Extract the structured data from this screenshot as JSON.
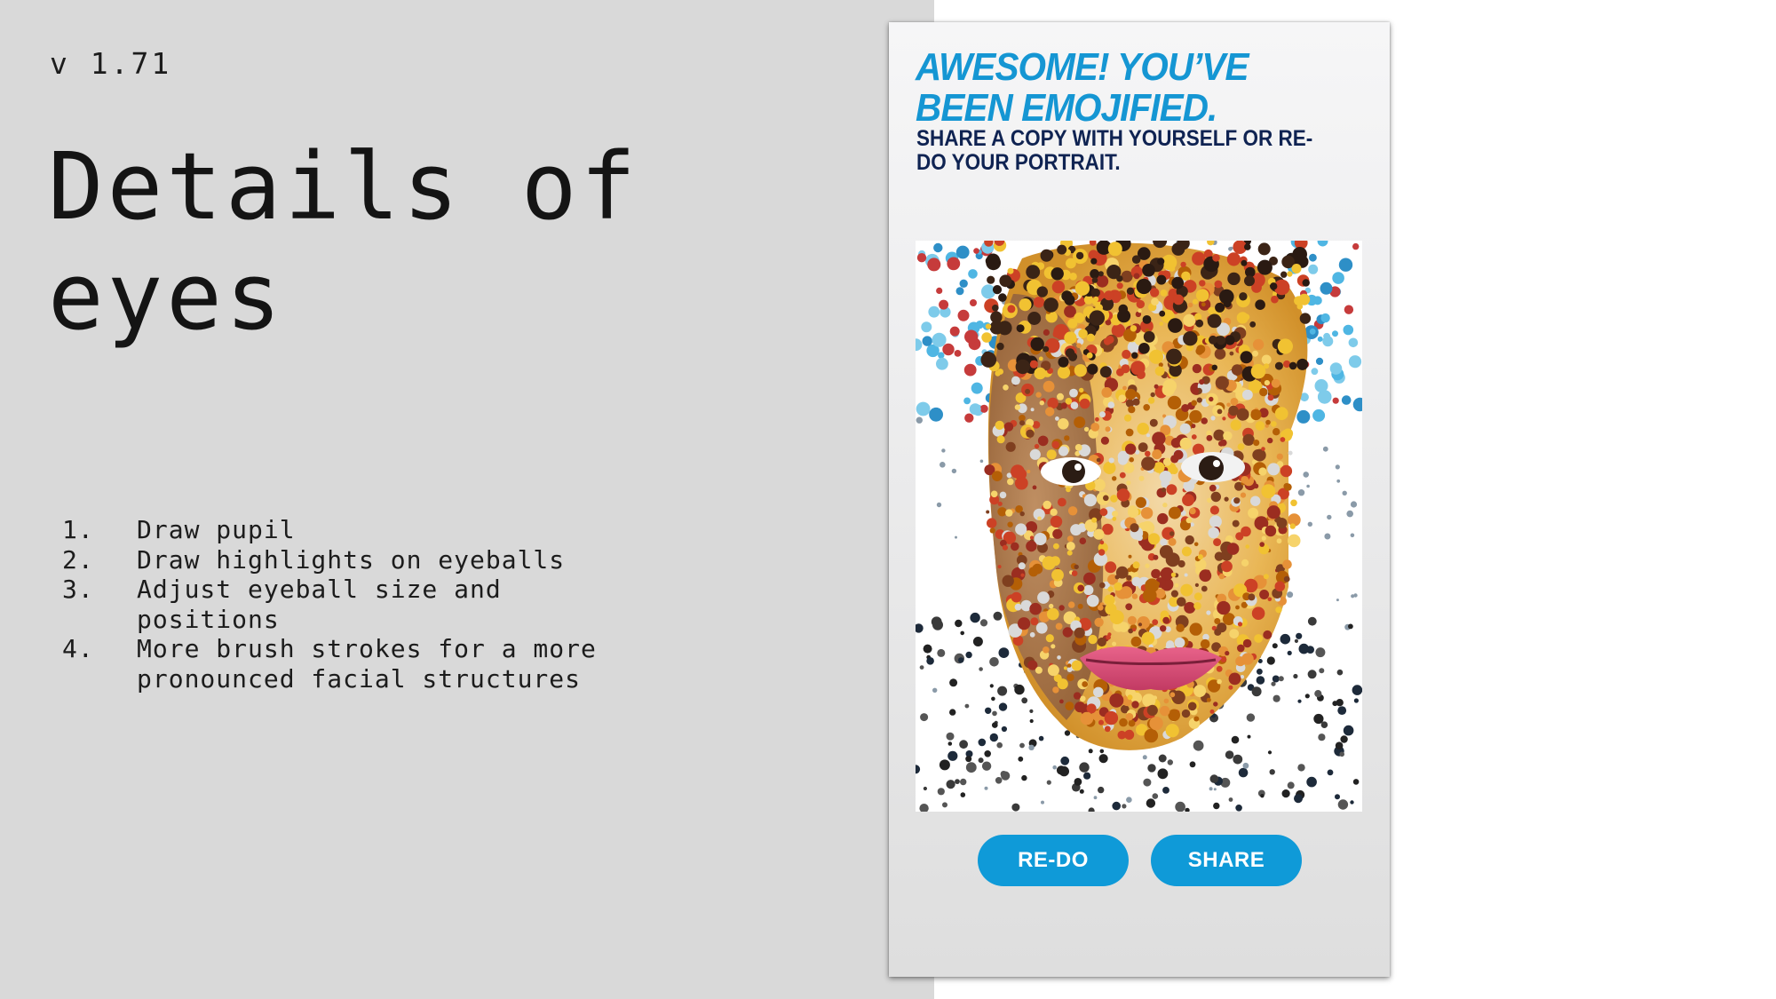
{
  "slide": {
    "version": "v 1.71",
    "title": "Details of eyes",
    "steps": [
      {
        "num": "1.",
        "text": "Draw pupil"
      },
      {
        "num": "2.",
        "text": "Draw highlights on eyeballs"
      },
      {
        "num": "3.",
        "text": "Adjust eyeball size and positions"
      },
      {
        "num": "4.",
        "text": "More brush strokes for a more pronounced facial structures"
      }
    ]
  },
  "app": {
    "headline": "AWESOME! YOU’VE BEEN EMOJIFIED.",
    "subheadline": "SHARE A COPY WITH YOURSELF OR RE-DO YOUR PORTRAIT.",
    "redo_label": "RE-DO",
    "share_label": "SHARE",
    "portrait_image_name": "emoji-mosaic-portrait"
  },
  "colors": {
    "slide_background": "#d9d9d9",
    "headline": "#1596d3",
    "subheadline": "#0f2352",
    "button": "#0f9ad8",
    "button_text": "#ffffff"
  }
}
